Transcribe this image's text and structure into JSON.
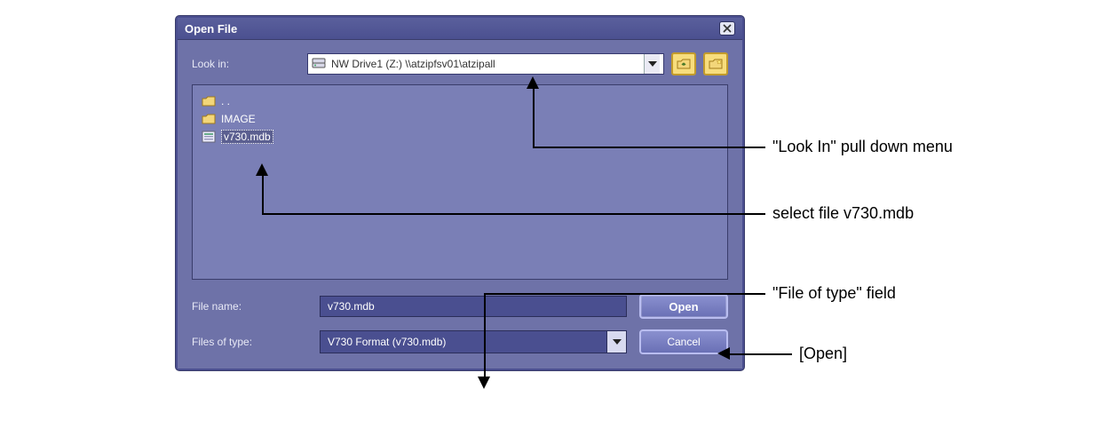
{
  "dialog": {
    "title": "Open File",
    "lookin_label": "Look in:",
    "lookin_value": "NW Drive1 (Z:) \\\\atzipfsv01\\atzipall",
    "items": [
      {
        "name": ". .",
        "kind": "folder-up"
      },
      {
        "name": "IMAGE",
        "kind": "folder"
      },
      {
        "name": "v730.mdb",
        "kind": "file",
        "selected": true
      }
    ],
    "filename_label": "File name:",
    "filename_value": "v730.mdb",
    "filetype_label": "Files of type:",
    "filetype_value": "V730 Format (v730.mdb)",
    "open_label": "Open",
    "cancel_label": "Cancel"
  },
  "icons": {
    "close": "close-icon",
    "drive": "network-drive-icon",
    "chevron_down": "chevron-down-icon",
    "up": "folder-up-icon",
    "new": "new-folder-icon",
    "folder": "folder-icon",
    "file": "file-icon"
  },
  "annotations": {
    "lookin": "\"Look In\" pull down menu",
    "selectfile": "select file v730.mdb",
    "filetype": "\"File of type\" field",
    "open": "[Open]"
  }
}
